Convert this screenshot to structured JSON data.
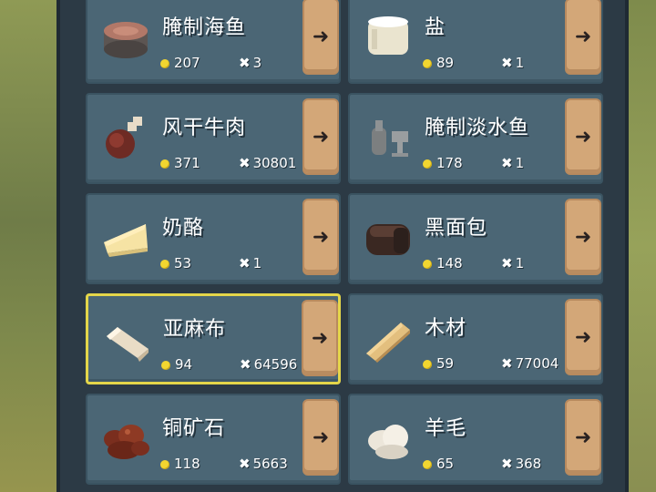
{
  "items": [
    {
      "name": "腌制海鱼",
      "price": "207",
      "qty": "3",
      "icon": "salted-fish-icon",
      "selected": false
    },
    {
      "name": "盐",
      "price": "89",
      "qty": "1",
      "icon": "salt-icon",
      "selected": false
    },
    {
      "name": "风干牛肉",
      "price": "371",
      "qty": "30801",
      "icon": "dried-beef-icon",
      "selected": false
    },
    {
      "name": "腌制淡水鱼",
      "price": "178",
      "qty": "1",
      "icon": "salted-freshwater-fish-icon",
      "selected": false
    },
    {
      "name": "奶酪",
      "price": "53",
      "qty": "1",
      "icon": "cheese-icon",
      "selected": false
    },
    {
      "name": "黑面包",
      "price": "148",
      "qty": "1",
      "icon": "black-bread-icon",
      "selected": false
    },
    {
      "name": "亚麻布",
      "price": "94",
      "qty": "64596",
      "icon": "linen-icon",
      "selected": true
    },
    {
      "name": "木材",
      "price": "59",
      "qty": "77004",
      "icon": "timber-icon",
      "selected": false
    },
    {
      "name": "铜矿石",
      "price": "118",
      "qty": "5663",
      "icon": "copper-ore-icon",
      "selected": false
    },
    {
      "name": "羊毛",
      "price": "65",
      "qty": "368",
      "icon": "wool-icon",
      "selected": false
    }
  ],
  "arrow_glyph": "➜",
  "colors": {
    "coin": "#f2d630",
    "selected_border": "#e4d64a",
    "button": "#d3a778",
    "card": "#4b6675"
  }
}
